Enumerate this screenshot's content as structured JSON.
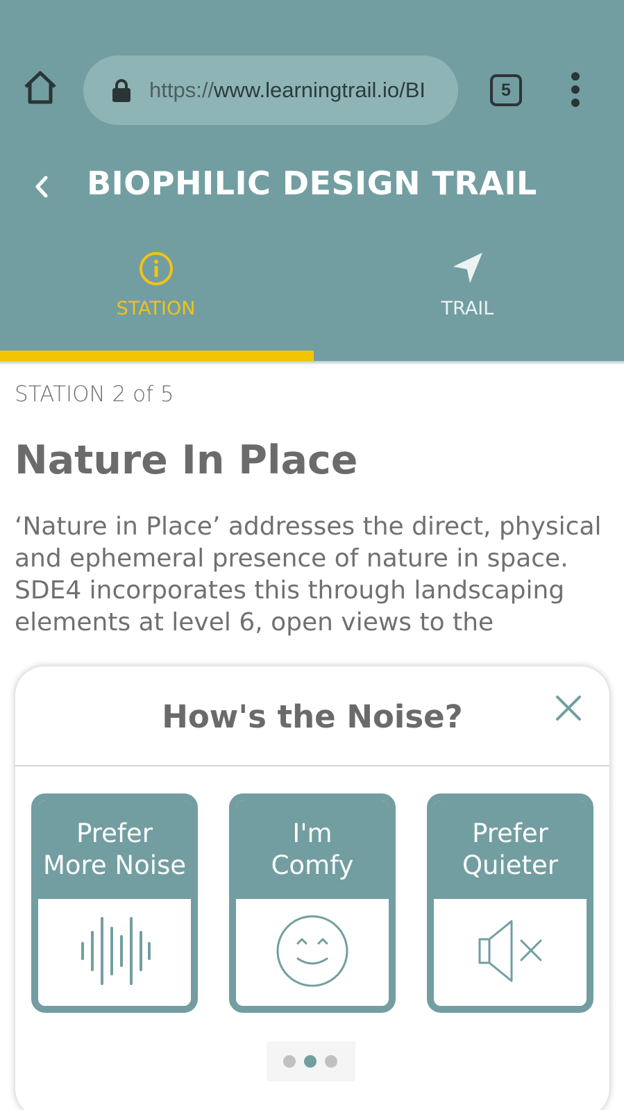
{
  "browser": {
    "url_protocol": "https://",
    "url_host": "www.learningtrail.io/BI",
    "tab_count": "5"
  },
  "header": {
    "title": "BIOPHILIC DESIGN TRAIL",
    "tabs": [
      {
        "label": "STATION",
        "icon": "info-icon",
        "active": true
      },
      {
        "label": "TRAIL",
        "icon": "navigation-arrow-icon",
        "active": false
      }
    ]
  },
  "station": {
    "counter": "STATION 2 of 5",
    "title": "Nature In Place",
    "body": "‘Nature in Place’ addresses the direct, physical and ephemeral presence of nature in space. SDE4 incorporates this through landscaping elements at level 6, open views to the"
  },
  "survey": {
    "title": "How's the Noise?",
    "options": [
      {
        "line1": "Prefer",
        "line2": "More Noise",
        "icon": "sound-wave-icon"
      },
      {
        "line1": "I'm",
        "line2": "Comfy",
        "icon": "smiley-icon"
      },
      {
        "line1": "Prefer",
        "line2": "Quieter",
        "icon": "speaker-mute-icon"
      }
    ],
    "page_count": 3,
    "active_page": 2
  },
  "colors": {
    "header_teal": "#729ea1",
    "accent_yellow": "#f5c400",
    "text_gray": "#6b6b6b"
  }
}
